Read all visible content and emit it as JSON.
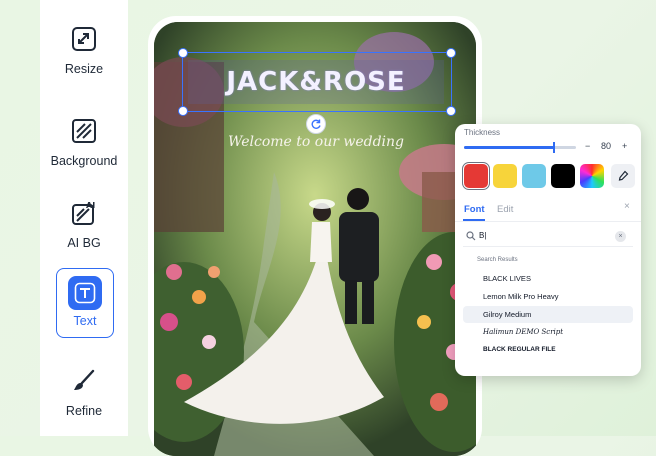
{
  "sidebar": {
    "items": [
      {
        "label": "Resize",
        "icon": "resize-icon"
      },
      {
        "label": "Background",
        "icon": "background-hatch-icon"
      },
      {
        "label": "AI BG",
        "icon": "ai-background-icon"
      },
      {
        "label": "Text",
        "icon": "text-t-icon",
        "active": true
      },
      {
        "label": "Refine",
        "icon": "brush-icon"
      }
    ]
  },
  "canvas": {
    "title_text": "JACK&ROSE",
    "subtitle_text": "Welcome to our wedding"
  },
  "panel": {
    "thickness_label": "Thickness",
    "thickness_value": "80",
    "thickness_fraction": 0.8,
    "minus": "−",
    "plus": "+",
    "colors": [
      "#e53935",
      "#f7d43a",
      "#6ec9e8",
      "#000000",
      "rainbow"
    ],
    "tabs": {
      "font": "Font",
      "edit": "Edit"
    },
    "close": "×",
    "search_value": "B|",
    "results_heading": "Search Results",
    "fonts": [
      "BLACK LIVES",
      "Lemon Milk Pro Heavy",
      "Gilroy Medium",
      "Halimun DEMO Script",
      "BLACK REGULAR FILE"
    ]
  },
  "colors": {
    "accent": "#2f6bf2",
    "selection": "#3a73ff"
  }
}
